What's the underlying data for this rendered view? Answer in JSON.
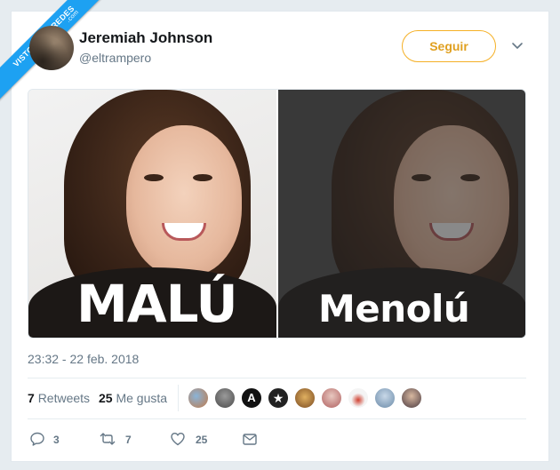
{
  "watermark": {
    "text": "VISTOENLASREDES",
    "sub": ".com"
  },
  "tweet": {
    "author_name": "Jeremiah Johnson",
    "author_handle": "@eltrampero",
    "follow_label": "Seguir",
    "media": {
      "left_caption": "MALÚ",
      "right_caption": "Menolú"
    },
    "timestamp": "23:32 - 22 feb. 2018",
    "stats": {
      "retweets_count": "7",
      "retweets_label": "Retweets",
      "likes_count": "25",
      "likes_label": "Me gusta"
    },
    "actions": {
      "replies": "3",
      "retweets": "7",
      "likes": "25"
    }
  },
  "colors": {
    "accent": "#1da1f2",
    "follow": "#f5b026",
    "muted": "#657786",
    "text": "#14171a"
  },
  "icons": [
    "chevron-down-icon",
    "reply-icon",
    "retweet-icon",
    "heart-icon",
    "envelope-icon"
  ]
}
